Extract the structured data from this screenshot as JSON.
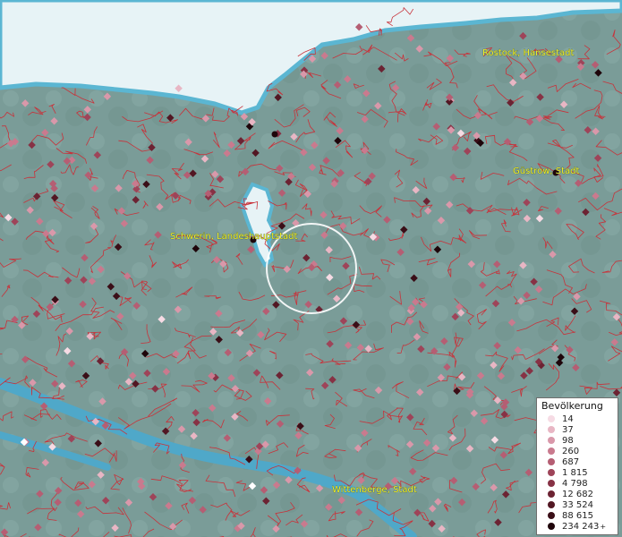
{
  "cities": [
    {
      "label": "Rostock, Hansestadt"
    },
    {
      "label": "Güstrow, Stadt"
    },
    {
      "label": "Schwerin, Landeshauptstadt"
    },
    {
      "label": "Wittenberge, Stadt"
    }
  ],
  "legend": {
    "title": "Bevölkerung",
    "items": [
      {
        "label": "14",
        "color": "#f6dbe4"
      },
      {
        "label": "37",
        "color": "#e8b6c4"
      },
      {
        "label": "98",
        "color": "#d998aa"
      },
      {
        "label": "260",
        "color": "#c97a8e"
      },
      {
        "label": "687",
        "color": "#b55e73"
      },
      {
        "label": "1 815",
        "color": "#9e4459"
      },
      {
        "label": "4 798",
        "color": "#873245"
      },
      {
        "label": "12 682",
        "color": "#6c2333"
      },
      {
        "label": "33 524",
        "color": "#521723"
      },
      {
        "label": "88 615",
        "color": "#3a0e17"
      },
      {
        "label": "234 243",
        "color": "#1e050a",
        "suffix": "+"
      }
    ]
  },
  "colors": {
    "land": "#7a9c98",
    "water": "#e7f3f6",
    "water_edge": "#5bb6d2",
    "boundaries": "#c8323a"
  }
}
